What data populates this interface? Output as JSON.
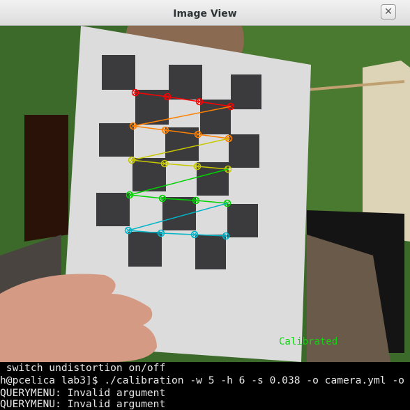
{
  "window": {
    "title": "Image View",
    "close_glyph": "✕"
  },
  "image_view": {
    "status_text": "Calibrated",
    "status_color": "#14d214",
    "board_pattern": {
      "columns": 5,
      "rows": 6
    },
    "row_colors": [
      "#ff0000",
      "#ff8000",
      "#c8c800",
      "#00d200",
      "#00b4c8"
    ]
  },
  "terminal": {
    "lines": [
      " switch undistortion on/off",
      "h@pcelica lab3]$ ./calibration -w 5 -h 6 -s 0.038 -o camera.yml -o",
      "QUERYMENU: Invalid argument",
      "QUERYMENU: Invalid argument"
    ]
  }
}
